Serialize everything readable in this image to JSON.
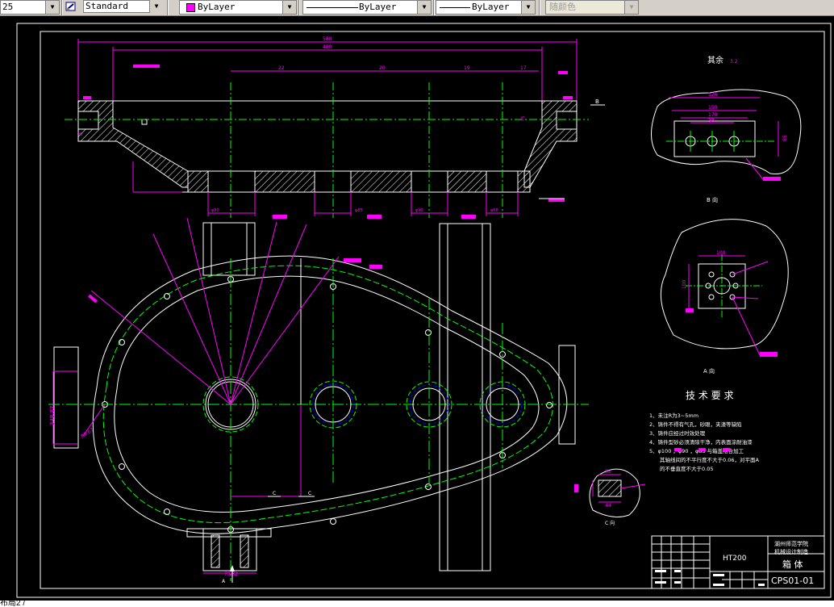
{
  "toolbar": {
    "scale_value": "25",
    "text_style": "Standard",
    "layer_color": "ByLayer",
    "linetype": "ByLayer",
    "lineweight": "ByLayer",
    "plot_style": "随颜色"
  },
  "drawing": {
    "top_view": {
      "dim_overall": "580",
      "dim_inner": "480",
      "dim_seg1": "22",
      "dim_seg2": "20",
      "dim_seg3": "19",
      "dim_seg4": "17",
      "dim_height": "75",
      "dim_left": "30",
      "bore_labels": [
        "φ80",
        "φ85",
        "φ90",
        "φ68"
      ],
      "section_label": "B"
    },
    "view_b": {
      "title": "其余",
      "caption": "B 向",
      "dims": [
        "126",
        "150",
        "170",
        "38",
        "65"
      ]
    },
    "view_a": {
      "caption": "A 向",
      "dims": [
        "100",
        "100"
      ]
    },
    "view_c": {
      "caption": "C 向",
      "dims": [
        "56",
        "44"
      ]
    },
    "front_view": {
      "dim_left": "348.87",
      "dim_r": "R9.67",
      "dim_bottom": "73.82",
      "section_marks": [
        "C",
        "C"
      ],
      "arrow_label": "A"
    },
    "tech_req": {
      "title": "技 术 要 求",
      "lines": [
        "1、未注R为3~5mm",
        "2、铸件不得有气孔，砂眼，夹渣等缺陷",
        "3、铸件应经过时效处理",
        "4、铸件型砂必须清除干净，内表面涂耐油漆",
        "5、φ100   ，φ90   ，φ85   与箱盖结合加工",
        "其轴线间的不平行度不大于0.06，对平面A",
        "的不垂直度不大于0.05"
      ]
    },
    "title_block": {
      "school": "湖州师范学院",
      "dept": "机械设计制造",
      "part_name": "箱 体",
      "material": "HT200",
      "drawing_no": "CPS01-01"
    }
  },
  "command_line": {
    "text": "布局2 /"
  },
  "colors": {
    "canvas": "#000000",
    "outline": "#ffffff",
    "center": "#00ff00",
    "dim": "#ff00ff",
    "hatch": "#ffffff",
    "hole": "#0000ff",
    "toolbar": "#d4d0c8"
  }
}
